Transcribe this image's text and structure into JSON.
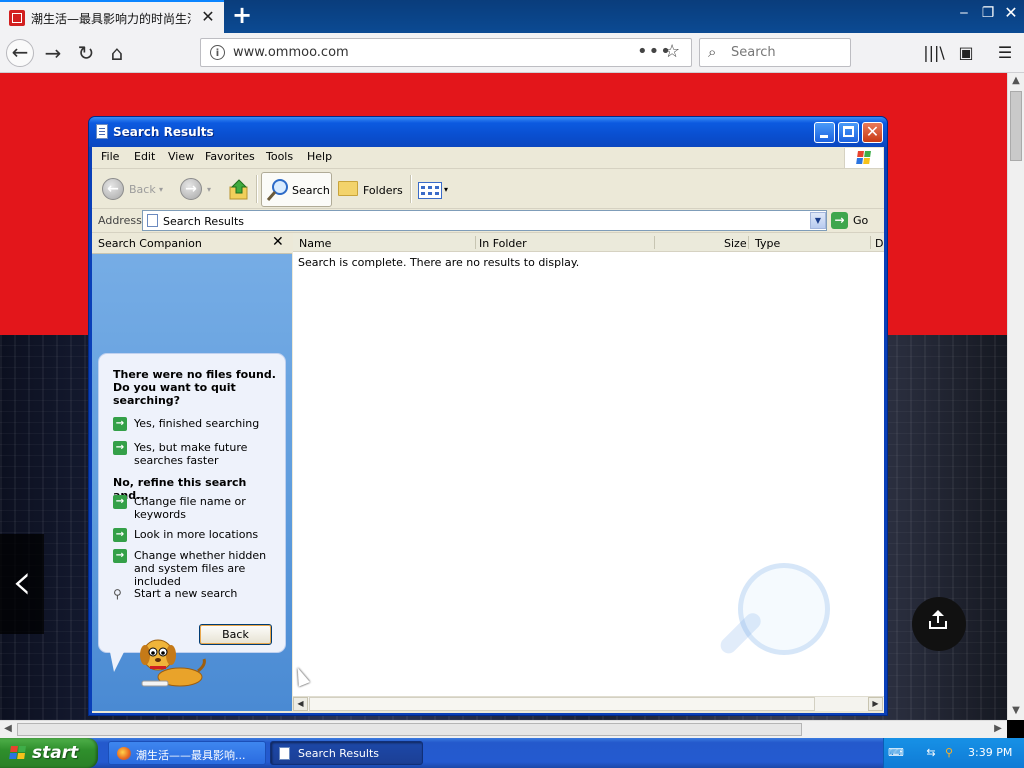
{
  "browser": {
    "tab_title": "潮生活—最具影响力的时尚生活门户",
    "url": "www.ommoo.com",
    "search_placeholder": "Search",
    "icons": {
      "back": "arrow-left-icon",
      "forward": "arrow-right-icon",
      "reload": "reload-icon",
      "home": "home-icon",
      "info": "info-icon",
      "page_actions": "more-dots-icon",
      "bookmark": "star-icon",
      "search": "search-icon",
      "library": "library-icon",
      "sidebar": "sidebar-icon",
      "menu": "hamburger-menu-icon"
    }
  },
  "webpage": {
    "brand_color": "#e3161b",
    "icons": {
      "carousel_prev": "chevron-left-icon",
      "share": "share-icon"
    }
  },
  "explorer": {
    "title": "Search Results",
    "menu": [
      "File",
      "Edit",
      "View",
      "Favorites",
      "Tools",
      "Help"
    ],
    "toolbar": {
      "back_label": "Back",
      "search_label": "Search",
      "folders_label": "Folders"
    },
    "address": {
      "label": "Address",
      "value": "Search Results",
      "go_label": "Go"
    },
    "companion": {
      "title": "Search Companion",
      "question": "There were no files found. Do you want to quit searching?",
      "options_quit": [
        "Yes, finished searching",
        "Yes, but make future searches faster"
      ],
      "refine_heading": "No, refine this search and...",
      "options_refine": [
        "Change file name or keywords",
        "Look in more locations",
        "Change whether hidden and system files are included"
      ],
      "new_search": "Start a new search",
      "back_button": "Back"
    },
    "columns": [
      "Name",
      "In Folder",
      "Size",
      "Type",
      "D"
    ],
    "empty_message": "Search is complete. There are no results to display."
  },
  "taskbar": {
    "start_label": "start",
    "buttons": [
      {
        "label": "潮生活——最具影响..."
      },
      {
        "label": "Search Results"
      }
    ],
    "clock": "3:39 PM"
  },
  "colors": {
    "xp_title_blue": "#0a4fd0",
    "xp_face": "#ece9d8",
    "start_green": "#2f8f2c",
    "tray_blue": "#0f7bd6"
  }
}
